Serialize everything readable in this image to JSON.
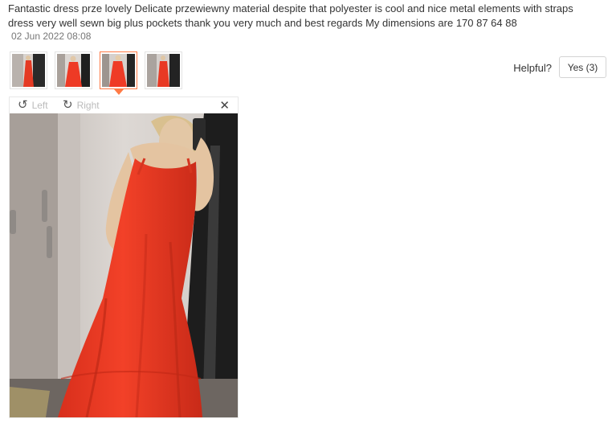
{
  "review": {
    "text": "Fantastic dress prze lovely Delicate przewiewny material despite that polyester is cool and nice metal elements with straps dress very well sewn big plus pockets thank you very much and best regards My dimensions are 170 87 64 88",
    "date": "02 Jun 2022 08:08"
  },
  "helpful": {
    "label": "Helpful?",
    "yes_button": "Yes (3)"
  },
  "thumbnails": {
    "count": 4,
    "active_index": 2
  },
  "viewer": {
    "rotate_left_label": "Left",
    "rotate_right_label": "Right",
    "rotate_left_icon": "rotate-left-icon",
    "rotate_right_icon": "rotate-right-icon",
    "close_icon": "close-icon"
  },
  "colors": {
    "accent": "#ff7a45",
    "dress": "#ef3b26",
    "text": "#333333",
    "muted": "#bbbbbb"
  }
}
